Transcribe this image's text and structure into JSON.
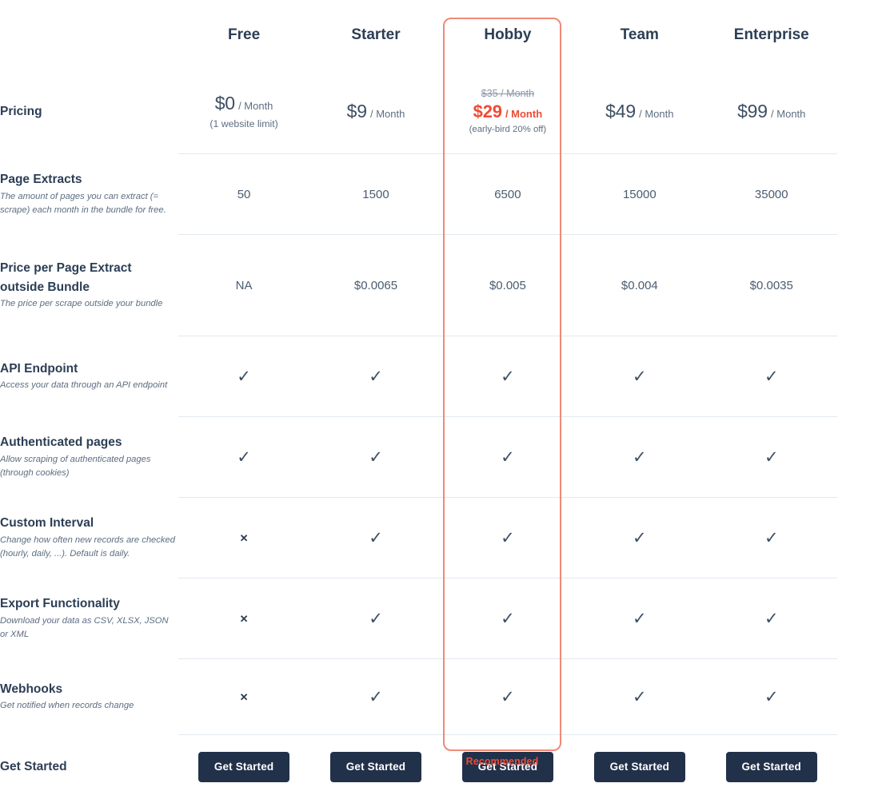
{
  "theme": {
    "accent": "#ef4b35",
    "accent_border": "#f08a77",
    "text_dark": "#2c3e55",
    "text_body": "#4a5b70",
    "text_muted": "#5d6e82",
    "button_bg": "#22314a",
    "divider": "#e3e9ef",
    "background": "#ffffff"
  },
  "plans": [
    {
      "name": "Free"
    },
    {
      "name": "Starter"
    },
    {
      "name": "Hobby",
      "recommended": true,
      "recommended_label": "Recommended"
    },
    {
      "name": "Team"
    },
    {
      "name": "Enterprise"
    }
  ],
  "rows": {
    "pricing": {
      "label": "Pricing",
      "description": "",
      "values": [
        {
          "old_price": "",
          "amount": "$0",
          "period": "/ Month",
          "sub": "(1 website limit)"
        },
        {
          "old_price": "",
          "amount": "$9",
          "period": "/ Month",
          "sub": ""
        },
        {
          "old_price": "$35 / Month",
          "amount": "$29",
          "period": "/ Month",
          "sub": "(early-bird 20% off)"
        },
        {
          "old_price": "",
          "amount": "$49",
          "period": "/ Month",
          "sub": ""
        },
        {
          "old_price": "",
          "amount": "$99",
          "period": "/ Month",
          "sub": ""
        }
      ]
    },
    "page_extracts": {
      "label": "Page Extracts",
      "description": "The amount of pages you can extract (= scrape) each month in the bundle for free.",
      "values": [
        "50",
        "1500",
        "6500",
        "15000",
        "35000"
      ]
    },
    "price_per_extract": {
      "label": "Price per Page Extract outside Bundle",
      "description": "The price per scrape outside your bundle",
      "values": [
        "NA",
        "$0.0065",
        "$0.005",
        "$0.004",
        "$0.0035"
      ]
    },
    "api_endpoint": {
      "label": "API Endpoint",
      "description": "Access your data through an API endpoint",
      "values": [
        "check",
        "check",
        "check",
        "check",
        "check"
      ]
    },
    "authenticated_pages": {
      "label": "Authenticated pages",
      "description": "Allow scraping of authenticated pages (through cookies)",
      "values": [
        "check",
        "check",
        "check",
        "check",
        "check"
      ]
    },
    "custom_interval": {
      "label": "Custom Interval",
      "description": "Change how often new records are checked (hourly, daily, ...). Default is daily.",
      "values": [
        "cross",
        "check",
        "check",
        "check",
        "check"
      ]
    },
    "export_functionality": {
      "label": "Export Functionality",
      "description": "Download your data as CSV, XLSX, JSON or XML",
      "values": [
        "cross",
        "check",
        "check",
        "check",
        "check"
      ]
    },
    "webhooks": {
      "label": "Webhooks",
      "description": "Get notified when records change",
      "values": [
        "cross",
        "check",
        "check",
        "check",
        "check"
      ]
    },
    "get_started": {
      "label": "Get Started",
      "button_label": "Get Started",
      "buttons": [
        "Get Started",
        "Get Started",
        "Get Started",
        "Get Started",
        "Get Started"
      ]
    }
  },
  "icons": {
    "check": "✓",
    "cross": "✕"
  }
}
